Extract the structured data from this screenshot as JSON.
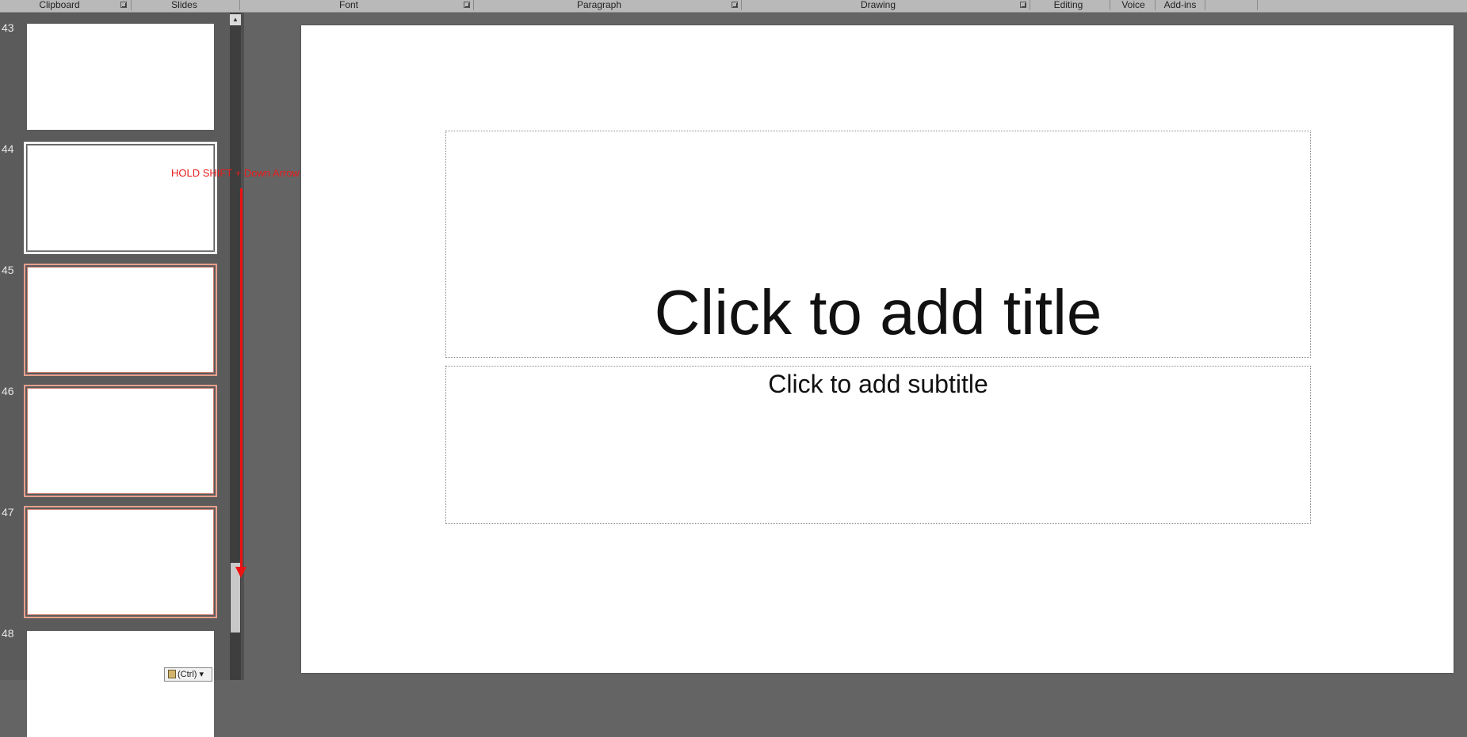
{
  "ribbon": {
    "groups": [
      {
        "label": "Clipboard"
      },
      {
        "label": "Slides"
      },
      {
        "label": "Font"
      },
      {
        "label": "Paragraph"
      },
      {
        "label": "Drawing"
      },
      {
        "label": "Editing"
      },
      {
        "label": "Voice"
      },
      {
        "label": "Add-ins"
      }
    ]
  },
  "thumbnails": [
    {
      "number": "43"
    },
    {
      "number": "44"
    },
    {
      "number": "45"
    },
    {
      "number": "46"
    },
    {
      "number": "47"
    },
    {
      "number": "48"
    }
  ],
  "annotation": {
    "text": "HOLD SHIFT + Down Arrow",
    "color": "#e81b1b"
  },
  "paste_options": {
    "label": "(Ctrl) ▾"
  },
  "slide": {
    "title_placeholder": "Click to add title",
    "subtitle_placeholder": "Click to add subtitle"
  },
  "colors": {
    "selection_outline": "#e9a08d",
    "ribbon_bg": "#b9b9b9",
    "pane_bg": "#646464"
  }
}
